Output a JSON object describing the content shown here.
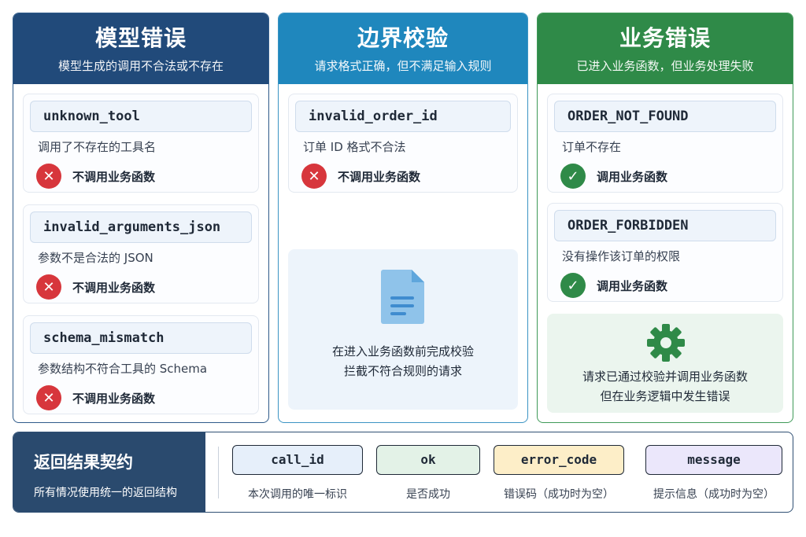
{
  "columns": [
    {
      "title": "模型错误",
      "subtitle": "模型生成的调用不合法或不存在",
      "cards": [
        {
          "code": "unknown_tool",
          "desc": "调用了不存在的工具名",
          "status": "不调用业务函数"
        },
        {
          "code": "invalid_arguments_json",
          "desc": "参数不是合法的 JSON",
          "status": "不调用业务函数"
        },
        {
          "code": "schema_mismatch",
          "desc": "参数结构不符合工具的 Schema",
          "status": "不调用业务函数"
        }
      ]
    },
    {
      "title": "边界校验",
      "subtitle": "请求格式正确，但不满足输入规则",
      "cards": [
        {
          "code": "invalid_order_id",
          "desc": "订单 ID 格式不合法",
          "status": "不调用业务函数"
        }
      ],
      "note": [
        "在进入业务函数前完成校验",
        "拦截不符合规则的请求"
      ]
    },
    {
      "title": "业务错误",
      "subtitle": "已进入业务函数，但业务处理失败",
      "cards": [
        {
          "code": "ORDER_NOT_FOUND",
          "desc": "订单不存在",
          "status": "调用业务函数"
        },
        {
          "code": "ORDER_FORBIDDEN",
          "desc": "没有操作该订单的权限",
          "status": "调用业务函数"
        }
      ],
      "note": [
        "请求已通过校验并调用业务函数",
        "但在业务逻辑中发生错误"
      ]
    }
  ],
  "contract": {
    "title": "返回结果契约",
    "subtitle": "所有情况使用统一的返回结构",
    "fields": [
      {
        "name": "call_id",
        "desc": "本次调用的唯一标识"
      },
      {
        "name": "ok",
        "desc": "是否成功"
      },
      {
        "name": "error_code",
        "desc": "错误码（成功时为空）"
      },
      {
        "name": "message",
        "desc": "提示信息（成功时为空）"
      }
    ]
  },
  "icons": {
    "fail": "cross-circle-icon",
    "success": "check-circle-icon",
    "document": "document-icon",
    "gear": "gear-icon"
  },
  "colors": {
    "model_error": "#214a7a",
    "boundary": "#1f87bd",
    "business": "#2f8a48",
    "fail": "#d7363c",
    "success": "#2f8a48"
  }
}
